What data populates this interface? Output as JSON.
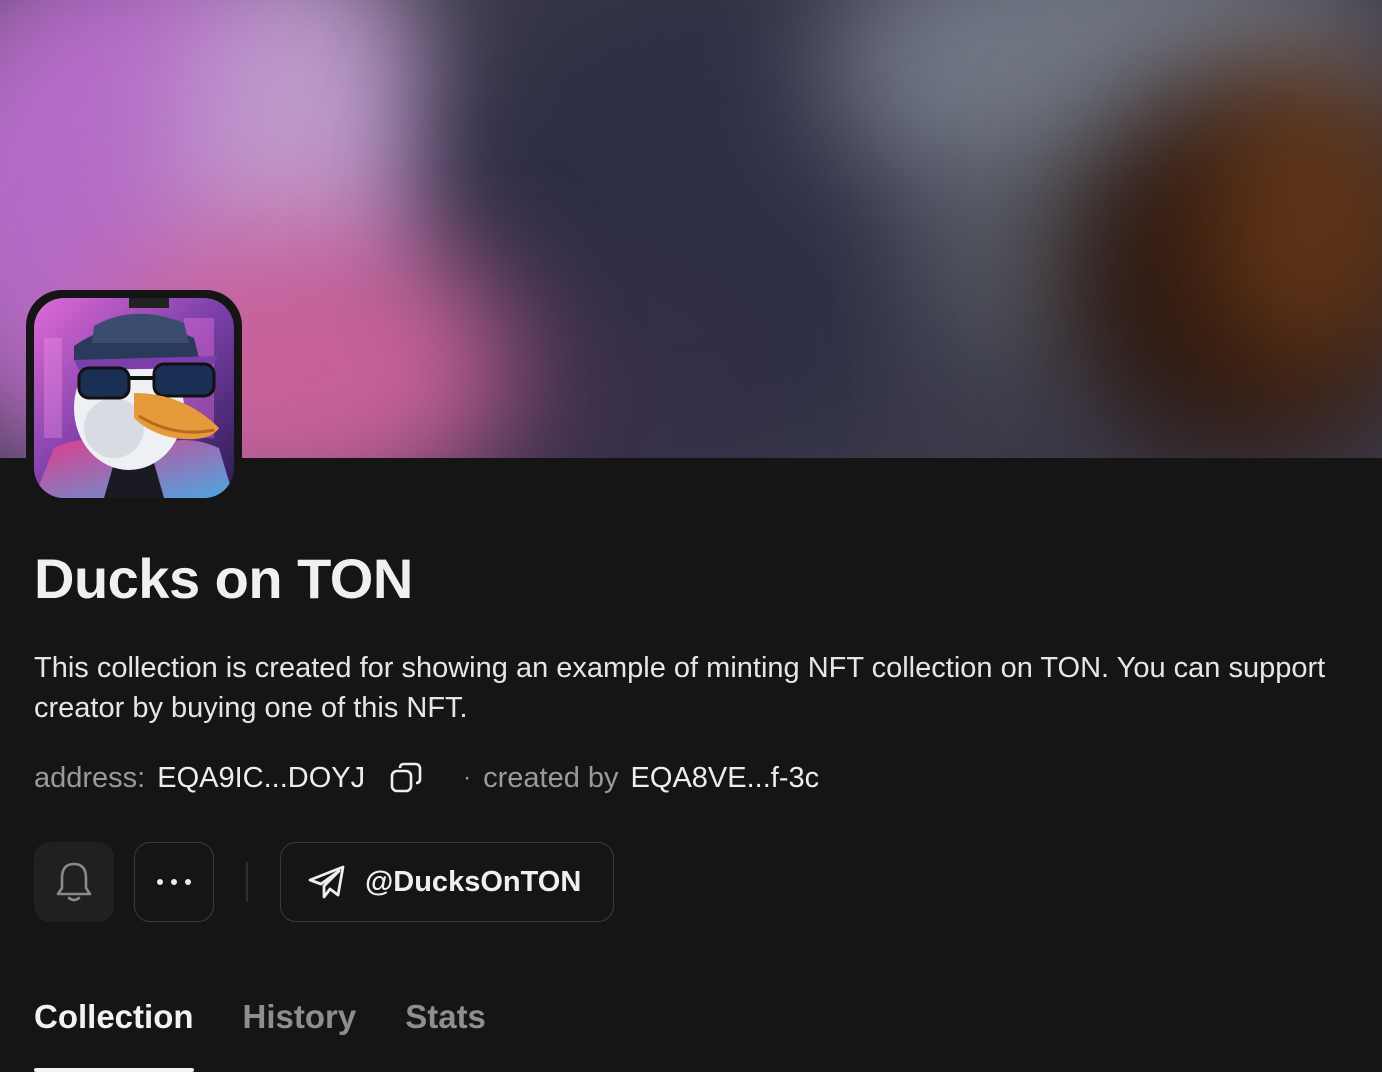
{
  "collection": {
    "title": "Ducks on TON",
    "description": "This collection is created for showing an example of minting NFT collection on TON. You can support creator by buying one of this NFT.",
    "address_label": "address:",
    "address_value": "EQA9IC...DOYJ",
    "separator": "·",
    "created_by_label": "created by",
    "creator_value": "EQA8VE...f-3c"
  },
  "actions": {
    "more_label": "···",
    "telegram_handle": "@DucksOnTON"
  },
  "tabs": [
    {
      "label": "Collection",
      "active": true
    },
    {
      "label": "History",
      "active": false
    },
    {
      "label": "Stats",
      "active": false
    }
  ],
  "icons": {
    "bell": "bell-icon",
    "more": "more-icon",
    "telegram": "telegram-icon",
    "copy": "copy-icon"
  },
  "colors": {
    "background": "#151515",
    "text_primary": "#f0f0f0",
    "text_muted": "#9a9a9a",
    "border": "#3a3a3a"
  }
}
